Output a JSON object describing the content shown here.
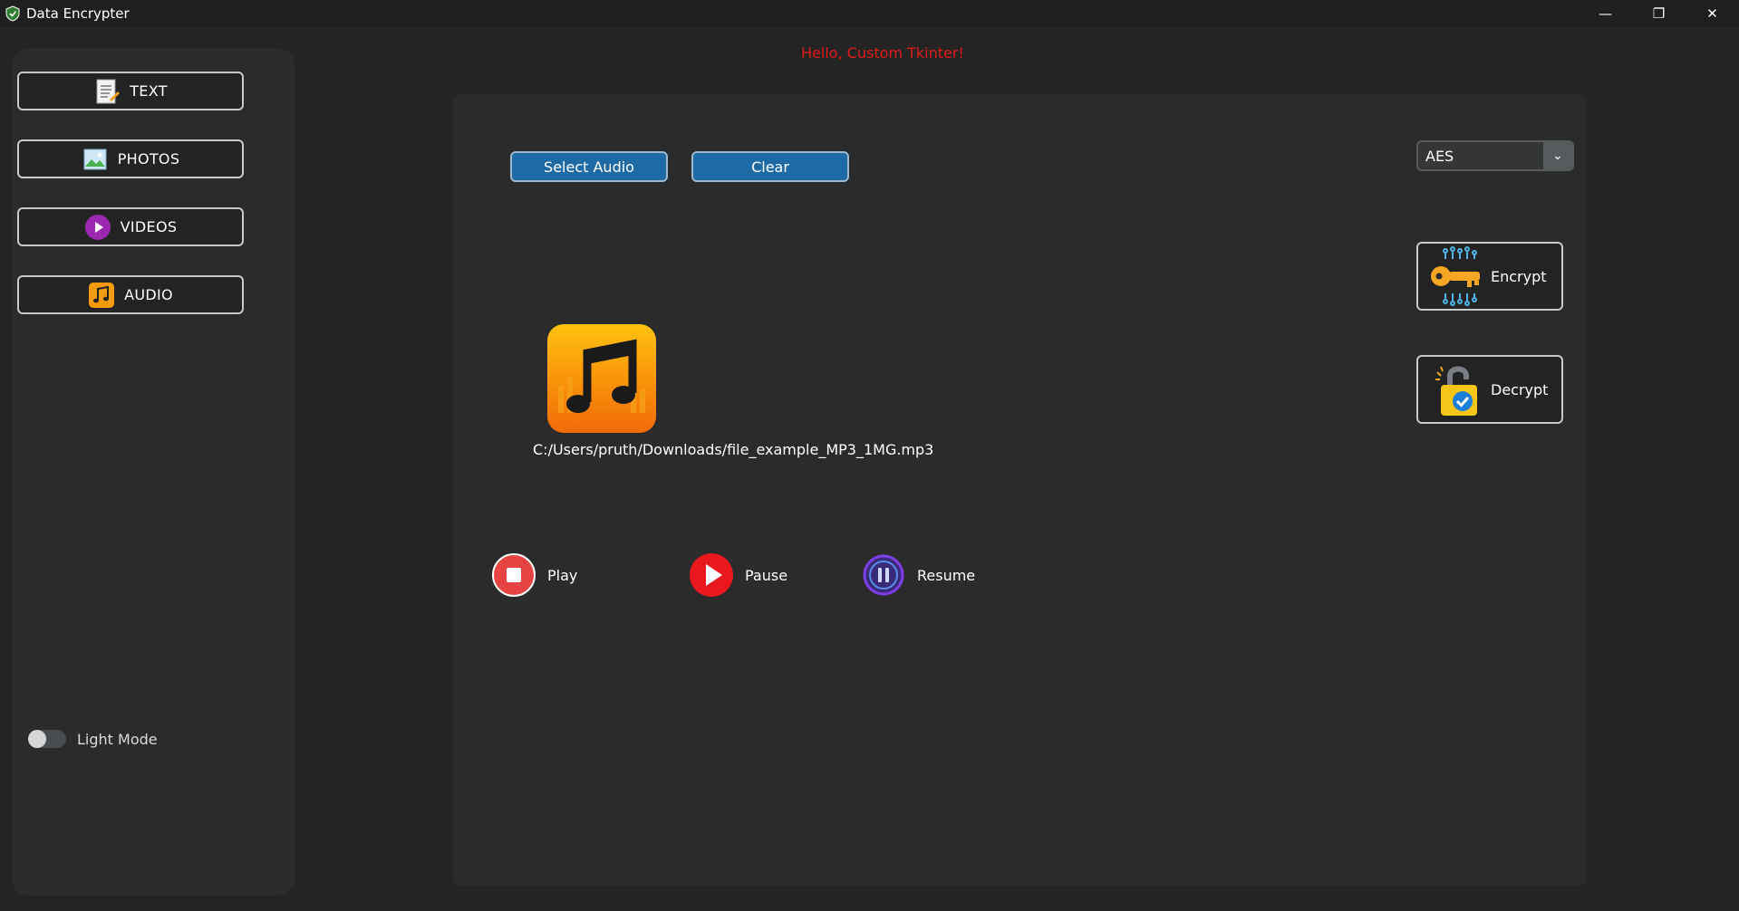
{
  "window": {
    "title": "Data Encrypter",
    "controls": {
      "minimize": "—",
      "restore": "❐",
      "close": "✕"
    }
  },
  "sidebar": {
    "items": [
      {
        "label": "TEXT",
        "icon": "document-icon"
      },
      {
        "label": "PHOTOS",
        "icon": "image-icon"
      },
      {
        "label": "VIDEOS",
        "icon": "play-circle-icon"
      },
      {
        "label": "AUDIO",
        "icon": "music-note-icon"
      }
    ],
    "theme_toggle": {
      "label": "Light Mode",
      "on": false
    }
  },
  "greeting": "Hello, Custom Tkinter!",
  "main": {
    "select_button": "Select Audio",
    "clear_button": "Clear",
    "algorithm": {
      "selected": "AES"
    },
    "encrypt_button": "Encrypt",
    "decrypt_button": "Decrypt",
    "file_path": "C:/Users/pruth/Downloads/file_example_MP3_1MG.mp3",
    "controls": {
      "play": "Play",
      "pause": "Pause",
      "resume": "Resume"
    }
  },
  "colors": {
    "accent_blue": "#1f6aa5",
    "greeting_red": "#e01b1b",
    "background": "#242424",
    "panel": "#2b2b2b"
  }
}
